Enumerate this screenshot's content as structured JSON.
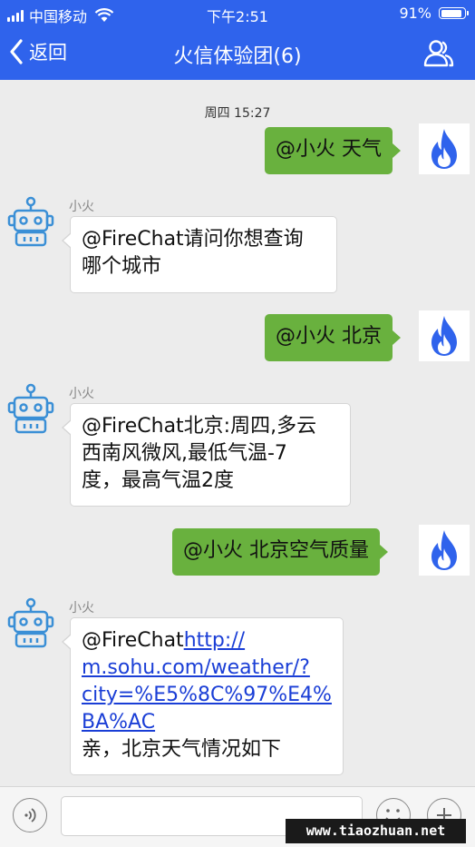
{
  "status_bar": {
    "carrier": "中国移动",
    "time": "下午2:51",
    "battery": "91%",
    "battery_level": 0.91
  },
  "nav": {
    "back_label": "返回",
    "title": "火信体验团(6)",
    "members_icon": "people-icon"
  },
  "chat": {
    "timestamp": "周四 15:27",
    "messages": [
      {
        "direction": "out",
        "text": "@小火 天气",
        "avatar": "flame-icon"
      },
      {
        "direction": "in",
        "sender": "小火",
        "line1": "@FireChat请问你想查询",
        "line2": "哪个城市",
        "avatar": "robot-icon"
      },
      {
        "direction": "out",
        "text": "@小火 北京",
        "avatar": "flame-icon"
      },
      {
        "direction": "in",
        "sender": "小火",
        "line1": "@FireChat北京:周四,多云",
        "line2": "西南风微风,最低气温-7",
        "line3": "度，最高气温2度",
        "avatar": "robot-icon"
      },
      {
        "direction": "out",
        "text": "@小火 北京空气质量",
        "avatar": "flame-icon"
      },
      {
        "direction": "in",
        "sender": "小火",
        "prefix": "@FireChat",
        "link_line1": "http://",
        "link_line2": "m.sohu.com/weather/?",
        "link_line3": "city=%E5%8C%97%E4%",
        "link_line4": "BA%AC",
        "suffix": "亲，北京天气情况如下",
        "avatar": "robot-icon"
      }
    ]
  },
  "input_bar": {
    "voice_icon": "voice-icon",
    "text_value": "",
    "emoji_icon": "emoji-icon",
    "plus_icon": "plus-icon"
  },
  "watermark": "www.tiaozhuan.net",
  "colors": {
    "brand_blue": "#2f63ec",
    "outgoing_bubble": "#69b13e",
    "incoming_bubble": "#ffffff",
    "flame": "#2f63ec",
    "robot": "#3a8fd6"
  }
}
